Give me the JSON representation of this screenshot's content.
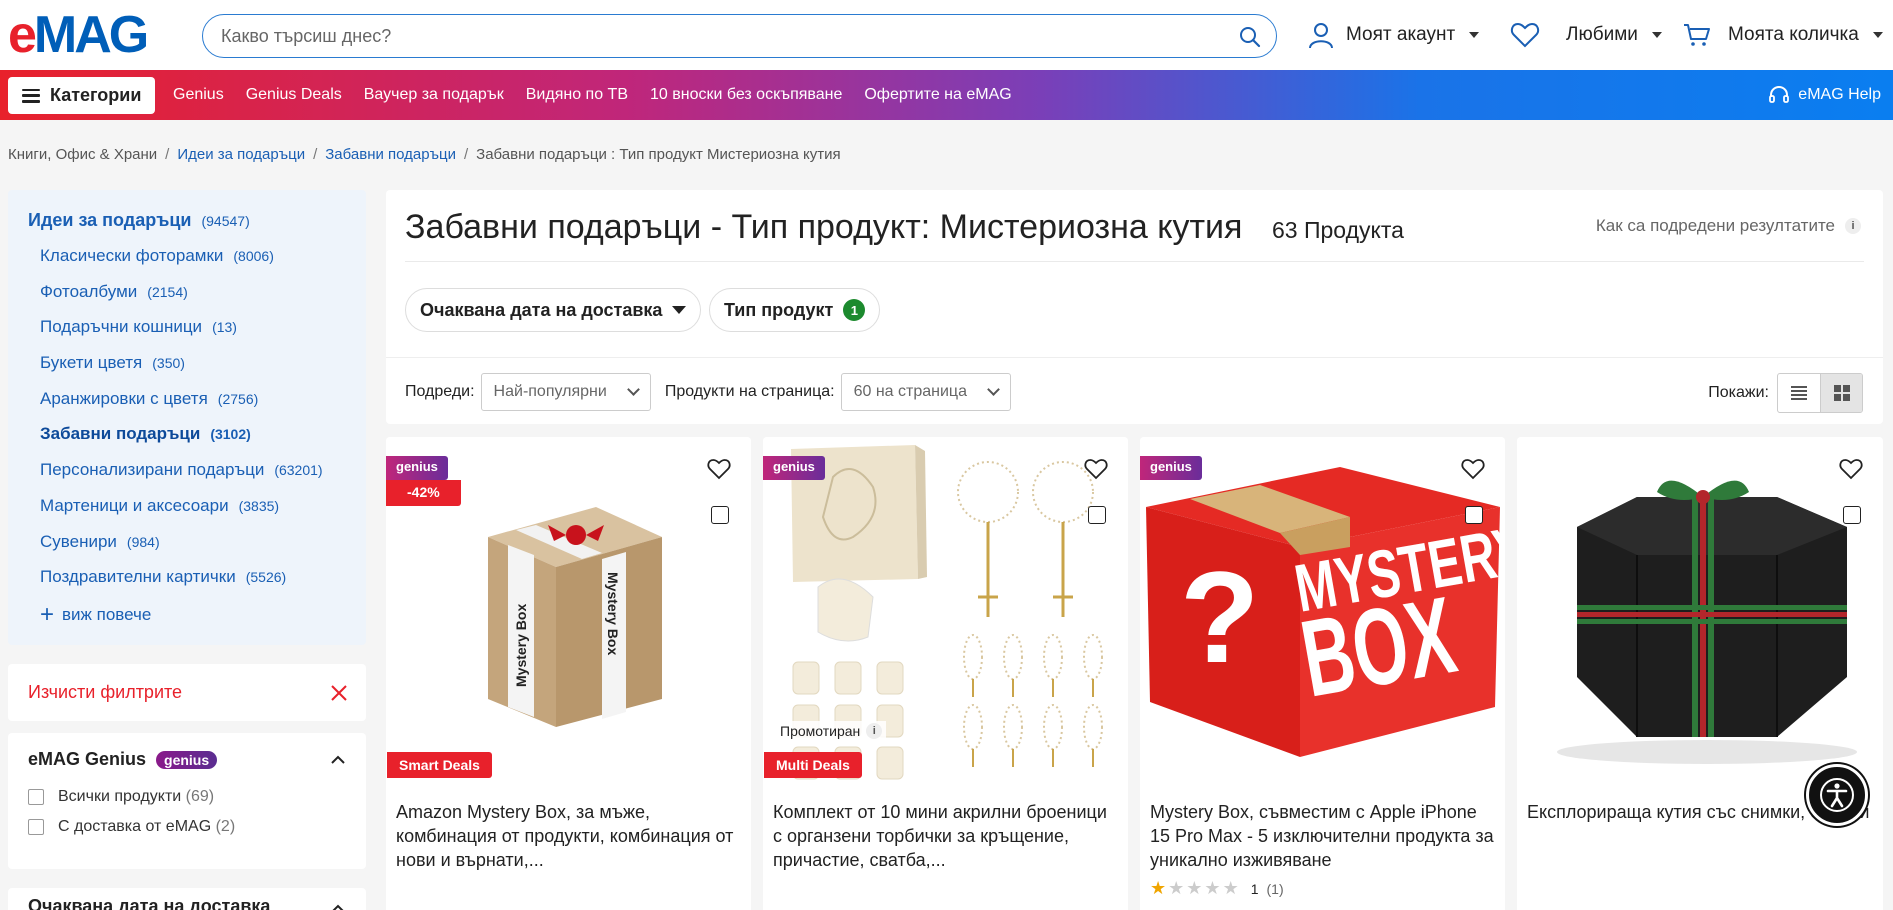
{
  "header": {
    "logo": "eMAG",
    "logo_e": "e",
    "logo_mag": "MAG",
    "search_placeholder": "Какво търсиш днес?",
    "account": "Моят акаунт",
    "favorites": "Любими",
    "cart": "Моята количка"
  },
  "nav": {
    "categories": "Категории",
    "links": [
      "Genius",
      "Genius Deals",
      "Ваучер за подарък",
      "Видяно по ТВ",
      "10 вноски без оскъпяване",
      "Офертите на eMAG"
    ],
    "help": "eMAG Help"
  },
  "breadcrumb": {
    "items": [
      "Книги, Офис & Храни",
      "Идеи за подаръци",
      "Забавни подаръци",
      "Забавни подаръци : Тип продукт Мистериозна кутия"
    ],
    "sep": "/"
  },
  "sidebar": {
    "title": "Идеи за подаръци",
    "title_count": "(94547)",
    "categories": [
      {
        "label": "Класически фоторамки",
        "count": "(8006)"
      },
      {
        "label": "Фотоалбуми",
        "count": "(2154)"
      },
      {
        "label": "Подаръчни кошници",
        "count": "(13)"
      },
      {
        "label": "Букети цветя",
        "count": "(350)"
      },
      {
        "label": "Аранжировки с цветя",
        "count": "(2756)"
      },
      {
        "label": "Забавни подаръци",
        "count": "(3102)"
      },
      {
        "label": "Персонализирани подаръци",
        "count": "(63201)"
      },
      {
        "label": "Мартеници и аксесоари",
        "count": "(3835)"
      },
      {
        "label": "Сувенири",
        "count": "(984)"
      },
      {
        "label": "Поздравителни картички",
        "count": "(5526)"
      }
    ],
    "see_more": "виж повече",
    "clear_filters": "Изчисти филтрите",
    "genius_title": "eMAG Genius",
    "genius_pill": "genius",
    "filters": [
      {
        "label": "Всички продукти",
        "count": "(69)"
      },
      {
        "label": "С доставка от eMAG",
        "count": "(2)"
      }
    ],
    "delivery_title": "Очаквана дата на доставка"
  },
  "main": {
    "title": "Забавни подаръци - Тип продукт: Мистериозна кутия",
    "count": "63 Продукта",
    "sort_info": "Как са подредени резултатите",
    "info_i": "i",
    "chip_delivery": "Очаквана дата на доставка",
    "chip_type": "Тип продукт",
    "chip_type_badge": "1",
    "sort_label": "Подреди:",
    "sort_value": "Най-популярни",
    "per_page_label": "Продукти на страница:",
    "per_page_value": "60 на страница",
    "show_label": "Покажи:"
  },
  "products": [
    {
      "genius": "genius",
      "discount": "-42%",
      "deal": "Smart Deals",
      "title": "Amazon Mystery Box, за мъже, комбинация от продукти, комбинация от нови и върнати,..."
    },
    {
      "genius": "genius",
      "promo": "Промотиран",
      "deal": "Multi Deals",
      "title": "Комплект от 10 мини акрилни броеници с органзени торбички за кръщение, причастие, сватба,..."
    },
    {
      "genius": "genius",
      "title": "Mystery Box, съвместим с Apple iPhone 15 Pro Max - 5 изключителни продукта за уникално изживяване",
      "rating_value": "1",
      "rating_count": "(1)",
      "rating_stars": 1
    },
    {
      "title": "Експлорираща кутия със снимки, снимки"
    }
  ],
  "colors": {
    "brand_red": "#e8212b",
    "brand_blue": "#005eb8",
    "link_blue": "#1a5fb4",
    "genius_purple": "#6a2d9a"
  }
}
